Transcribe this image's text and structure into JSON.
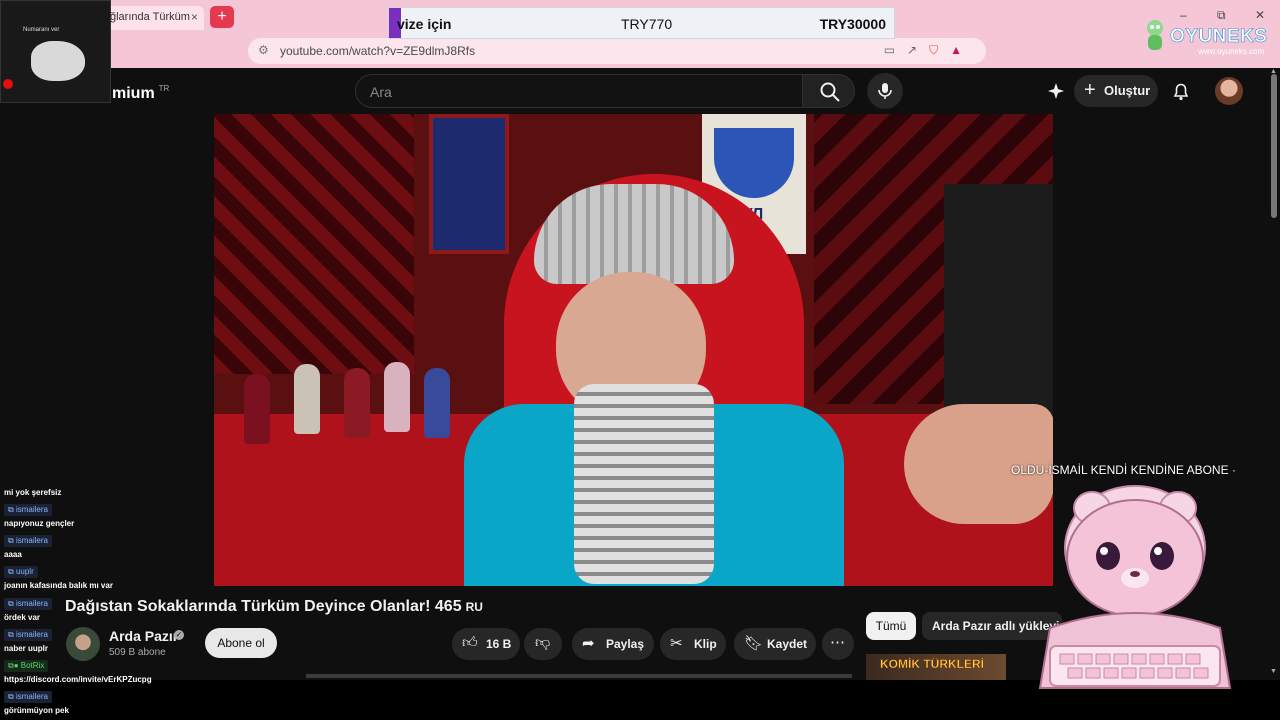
{
  "browser": {
    "tab_title": "ğlarında Türküm",
    "tab_close": "×",
    "new_tab": "+",
    "url": "youtube.com/watch?v=ZE9dlmJ8Rfs",
    "window_controls": [
      "–",
      "⧉",
      "✕"
    ]
  },
  "price_bar": {
    "label": "vize için",
    "price_1": "TRY770",
    "price_2": "TRY30000"
  },
  "brand_overlay": {
    "name": "OYUNEKS",
    "site": "www.oyuneks.com"
  },
  "webcam": {
    "caption": "Numaranı ver"
  },
  "youtube_header": {
    "logo_text": "mium",
    "region": "TR",
    "search_placeholder": "Ara",
    "create_label": "Oluştur"
  },
  "video": {
    "banner_text": "АГУЛ",
    "title": "Dağıstan Sokaklarında Türküm Deyince Olanlar! 465",
    "title_tag": "RU"
  },
  "channel": {
    "name": "Arda Pazır",
    "subscribers": "509 B abone",
    "subscribe_label": "Abone ol"
  },
  "actions": {
    "like_count": "16 B",
    "share_label": "Paylaş",
    "clip_label": "Klip",
    "save_label": "Kaydet"
  },
  "recommendations": {
    "chip_all": "Tümü",
    "chip_uploads": "Arda Pazır adlı yükleyicinin",
    "thumbnail_text": "KOMİK TÜRKLERİ"
  },
  "chat": {
    "messages": [
      {
        "user": "",
        "text": "mi yok şerefsiz"
      },
      {
        "user": "ismailera",
        "text": "napıyonuz gençler"
      },
      {
        "user": "ismailera",
        "text": "aaaa"
      },
      {
        "user": "uuplr",
        "text": "joanın kafasında balık mı var"
      },
      {
        "user": "ismailera",
        "text": "ördek var"
      },
      {
        "user": "ismailera",
        "text": "naber uuplr"
      },
      {
        "user": "BotRix",
        "text": "https://discord.com/invite/vErKPZucpg"
      },
      {
        "user": "ismailera",
        "text": "görünmüyon pek"
      }
    ]
  },
  "alert": {
    "text": "OLDU-İSMAİL KENDİ KENDİNE ABONE ·"
  },
  "colors": {
    "browser_chrome": "#f5c6d6",
    "youtube_bg": "#0f0f0f",
    "price_stripe": "#7b2fbf"
  }
}
